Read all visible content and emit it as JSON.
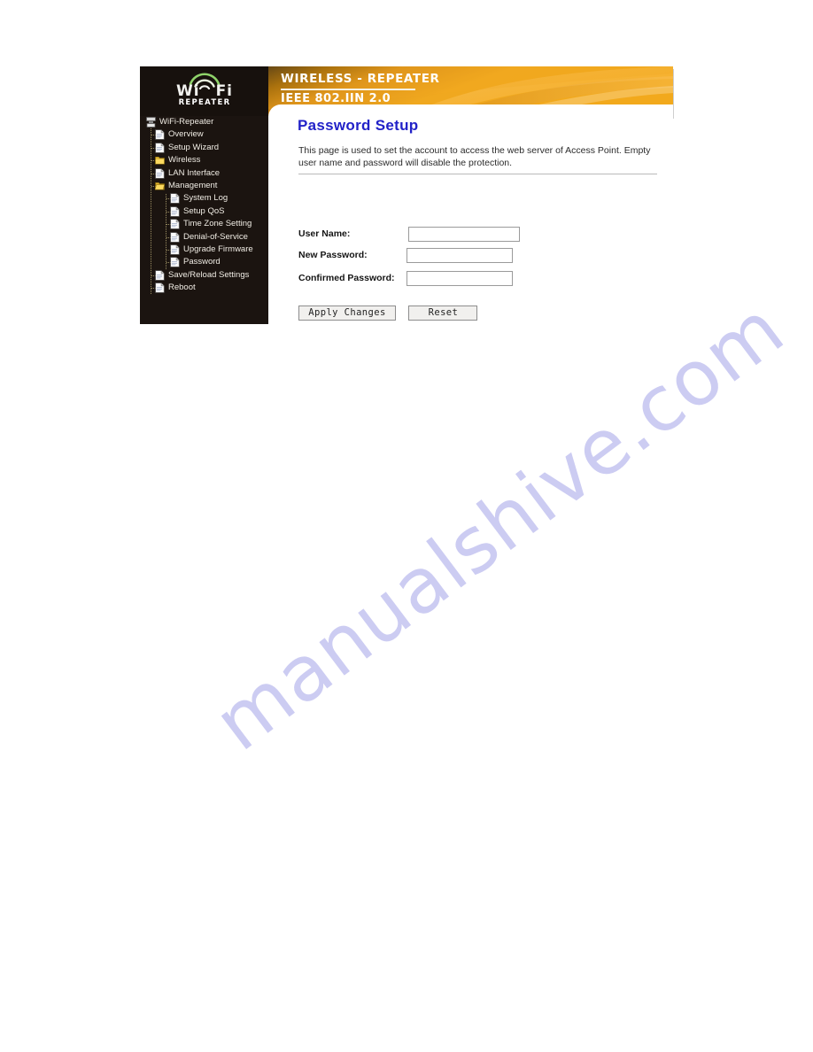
{
  "watermark": {
    "text": "manualshive.com"
  },
  "logo": {
    "word_left": "Wi",
    "word_right": "Fi",
    "subtitle": "REPEATER",
    "icon": "wifi-signal-icon"
  },
  "banner": {
    "title": "WIRELESS - REPEATER",
    "subtitle": "IEEE 802.IIN 2.0",
    "accent_color": "#f0a01e",
    "accent_color_dark": "#d98613"
  },
  "page": {
    "title": "Password Setup",
    "title_color": "#2222c8",
    "description": "This page is used to set the account to access the web server of Access Point. Empty user name and password will disable the protection."
  },
  "form": {
    "fields": [
      {
        "label": "User Name:",
        "value": "",
        "placeholder": "",
        "name": "user-name"
      },
      {
        "label": "New Password:",
        "value": "",
        "placeholder": "",
        "name": "new-password"
      },
      {
        "label": "Confirmed Password:",
        "value": "",
        "placeholder": "",
        "name": "confirmed-password"
      }
    ],
    "buttons": {
      "apply": "Apply Changes",
      "reset": "Reset"
    }
  },
  "sidebar": {
    "items": [
      {
        "label": "WiFi-Repeater",
        "level": 0,
        "icon": "device-icon"
      },
      {
        "label": "Overview",
        "level": 1,
        "icon": "page-icon"
      },
      {
        "label": "Setup Wizard",
        "level": 1,
        "icon": "page-icon"
      },
      {
        "label": "Wireless",
        "level": 1,
        "icon": "folder-icon"
      },
      {
        "label": "LAN Interface",
        "level": 1,
        "icon": "page-icon"
      },
      {
        "label": "Management",
        "level": 1,
        "icon": "folder-open-icon"
      },
      {
        "label": "System Log",
        "level": 2,
        "icon": "page-icon"
      },
      {
        "label": "Setup QoS",
        "level": 2,
        "icon": "page-icon"
      },
      {
        "label": "Time Zone Setting",
        "level": 2,
        "icon": "page-icon"
      },
      {
        "label": "Denial-of-Service",
        "level": 2,
        "icon": "page-icon"
      },
      {
        "label": "Upgrade Firmware",
        "level": 2,
        "icon": "page-icon"
      },
      {
        "label": "Password",
        "level": 2,
        "icon": "page-icon"
      },
      {
        "label": "Save/Reload Settings",
        "level": 1,
        "icon": "page-icon"
      },
      {
        "label": "Reboot",
        "level": 1,
        "icon": "page-icon"
      }
    ]
  }
}
